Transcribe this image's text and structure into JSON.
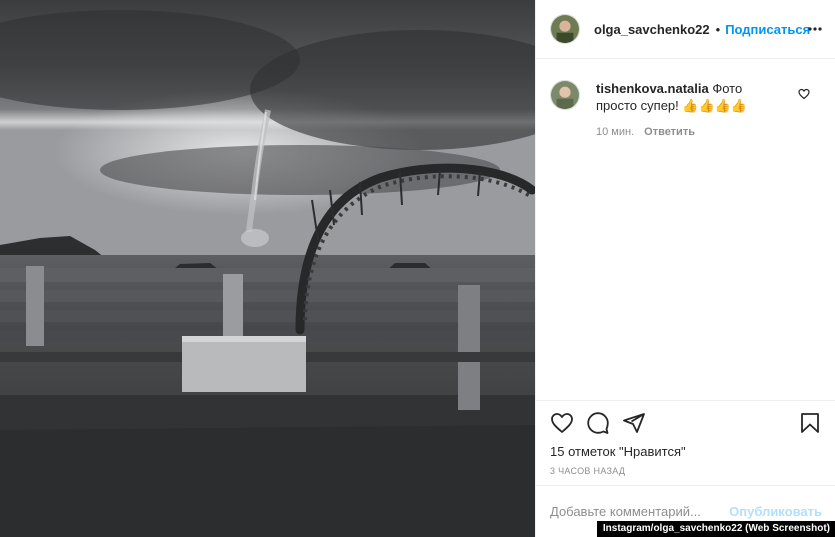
{
  "post": {
    "author": {
      "username": "olga_savchenko22",
      "separator": "•",
      "follow_label": "Подписаться"
    },
    "photo": {
      "alt": "photo"
    },
    "comments": [
      {
        "username": "tishenkova.natalia",
        "text": "Фото просто супер! 👍👍👍👍",
        "time": "10 мин.",
        "reply_label": "Ответить"
      }
    ],
    "likes_text": "15 отметок \"Нравится\"",
    "posted_ago": "3 часов назад",
    "add_comment": {
      "placeholder": "Добавьте комментарий...",
      "publish_label": "Опубликовать"
    }
  },
  "icons": {
    "more": "more-options-icon",
    "like": "heart-icon",
    "comment": "comment-icon",
    "share": "share-icon",
    "save": "bookmark-icon"
  },
  "colors": {
    "accent": "#0095f6",
    "muted": "#8e8e8e",
    "publish_disabled": "#b2dffc"
  },
  "watermark": "Instagram/olga_savchenko22 (Web Screenshot)"
}
